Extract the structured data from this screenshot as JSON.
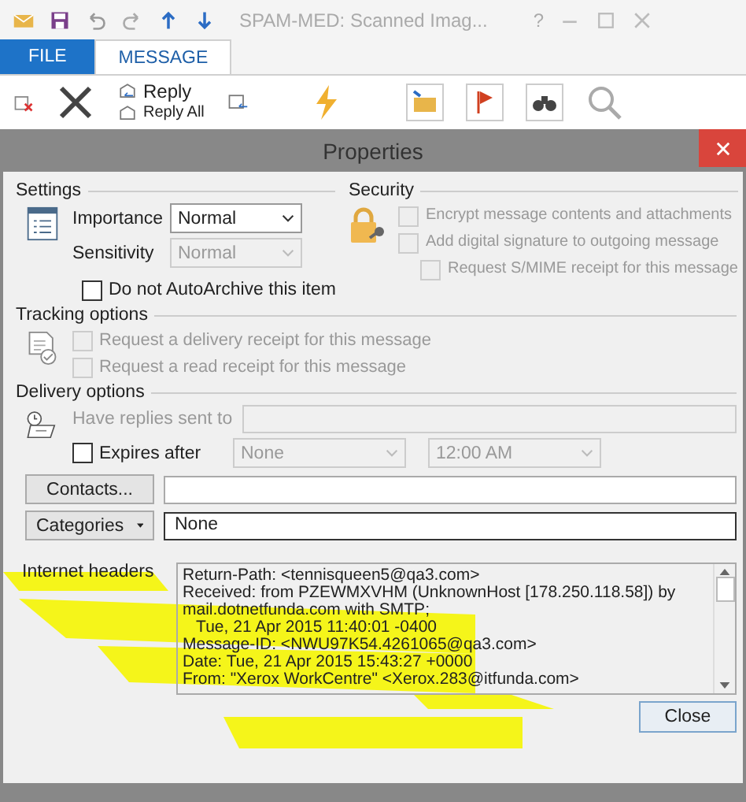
{
  "app": {
    "title": "SPAM-MED: Scanned Imag...",
    "help": "?"
  },
  "tabs": [
    {
      "label": "FILE",
      "kind": "file",
      "selected": false
    },
    {
      "label": "MESSAGE",
      "kind": "tab",
      "selected": true
    }
  ],
  "ribbon": {
    "reply": "Reply",
    "reply_all": "Reply All"
  },
  "dialog": {
    "title": "Properties",
    "settings": {
      "heading": "Settings",
      "fields": [
        {
          "label": "Importance",
          "value": "Normal",
          "disabled": false
        },
        {
          "label": "Sensitivity",
          "value": "Normal",
          "disabled": true
        }
      ],
      "autoarchive": {
        "label": "Do not AutoArchive this item",
        "checked": false,
        "disabled": false
      }
    },
    "security": {
      "heading": "Security",
      "options": [
        {
          "label": "Encrypt message contents and attachments",
          "checked": false,
          "disabled": true
        },
        {
          "label": "Add digital signature to outgoing message",
          "checked": false,
          "disabled": true,
          "children": [
            {
              "label": "Request S/MIME receipt for this message",
              "checked": false,
              "disabled": true
            }
          ]
        }
      ]
    },
    "tracking": {
      "heading": "Tracking options",
      "options": [
        {
          "label": "Request a delivery receipt for this message",
          "checked": false,
          "disabled": true
        },
        {
          "label": "Request a read receipt for this message",
          "checked": false,
          "disabled": true
        }
      ]
    },
    "delivery": {
      "heading": "Delivery options",
      "replies": {
        "label": "Have replies sent to",
        "disabled": true
      },
      "expires": {
        "label": "Expires after",
        "checked": false,
        "date": "None",
        "time": "12:00 AM"
      }
    },
    "contacts": {
      "button": "Contacts..."
    },
    "categories": {
      "button": "Categories",
      "value": "None"
    },
    "headers": {
      "label": "Internet headers",
      "lines": [
        "Return-Path: <tennisqueen5@qa3.com>",
        "Received: from PZEWMXVHM (UnknownHost [178.250.118.58]) by",
        "mail.dotnetfunda.com with SMTP;",
        "   Tue, 21 Apr 2015 11:40:01 -0400",
        "Message-ID: <NWU97K54.4261065@qa3.com>",
        "Date: Tue, 21 Apr 2015 15:43:27 +0000",
        "From: \"Xerox WorkCentre\" <Xerox.283@itfunda.com>"
      ]
    },
    "close": "Close"
  }
}
